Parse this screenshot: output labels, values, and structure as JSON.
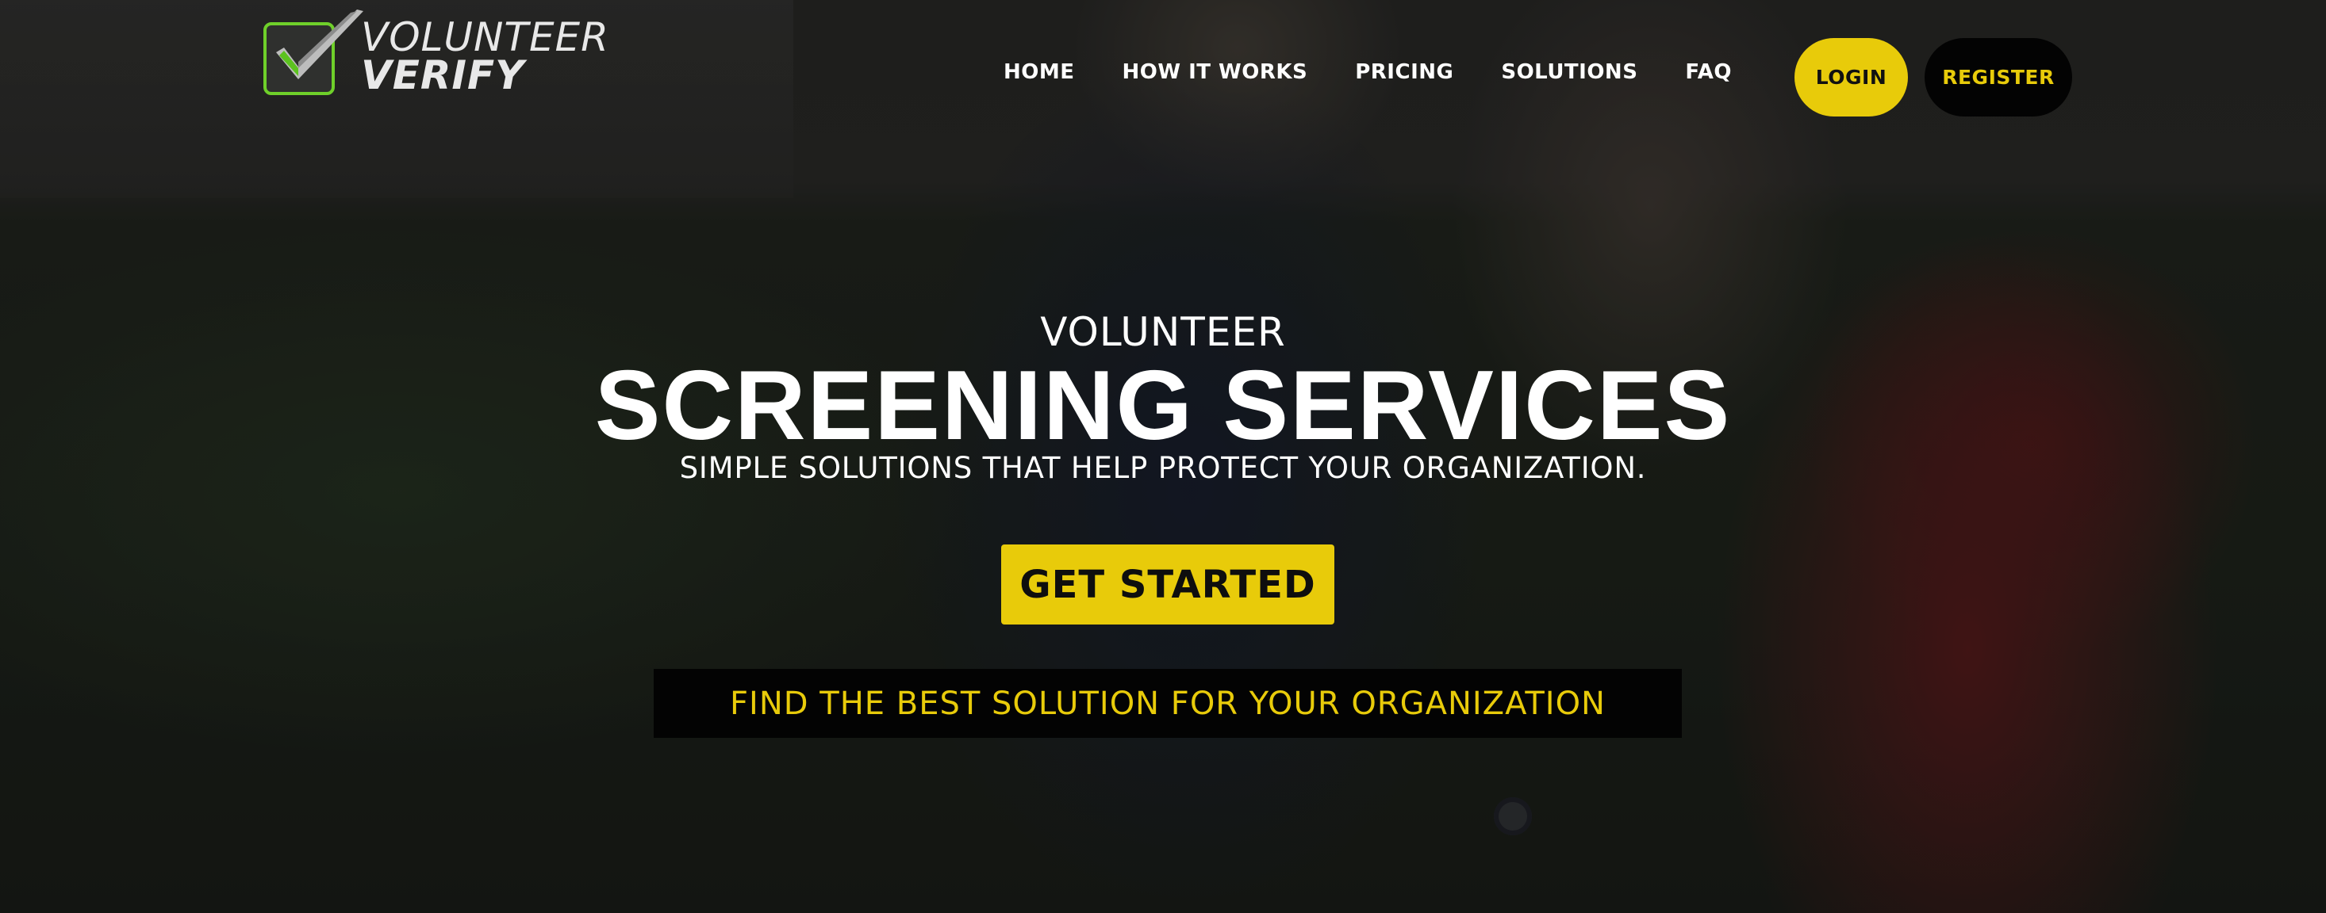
{
  "brand": {
    "name_line1": "VOLUNTEER",
    "name_line2": "VERIFY",
    "logo_icon": "checkbox-check-icon",
    "check_color": "#5cc21f",
    "frame_color": "#6fd02a"
  },
  "nav": {
    "items": [
      {
        "label": "HOME"
      },
      {
        "label": "HOW IT WORKS"
      },
      {
        "label": "PRICING"
      },
      {
        "label": "SOLUTIONS"
      },
      {
        "label": "FAQ"
      }
    ],
    "login_label": "LOGIN",
    "register_label": "REGISTER"
  },
  "hero": {
    "eyebrow": "VOLUNTEER",
    "title": "SCREENING SERVICES",
    "subtitle": "SIMPLE SOLUTIONS THAT HELP PROTECT YOUR ORGANIZATION.",
    "cta_primary": "GET STARTED",
    "cta_secondary": "FIND THE BEST SOLUTION FOR YOUR ORGANIZATION"
  },
  "colors": {
    "accent_yellow": "#e8cb0a",
    "dark_button": "#030303",
    "text_white": "#ffffff"
  }
}
